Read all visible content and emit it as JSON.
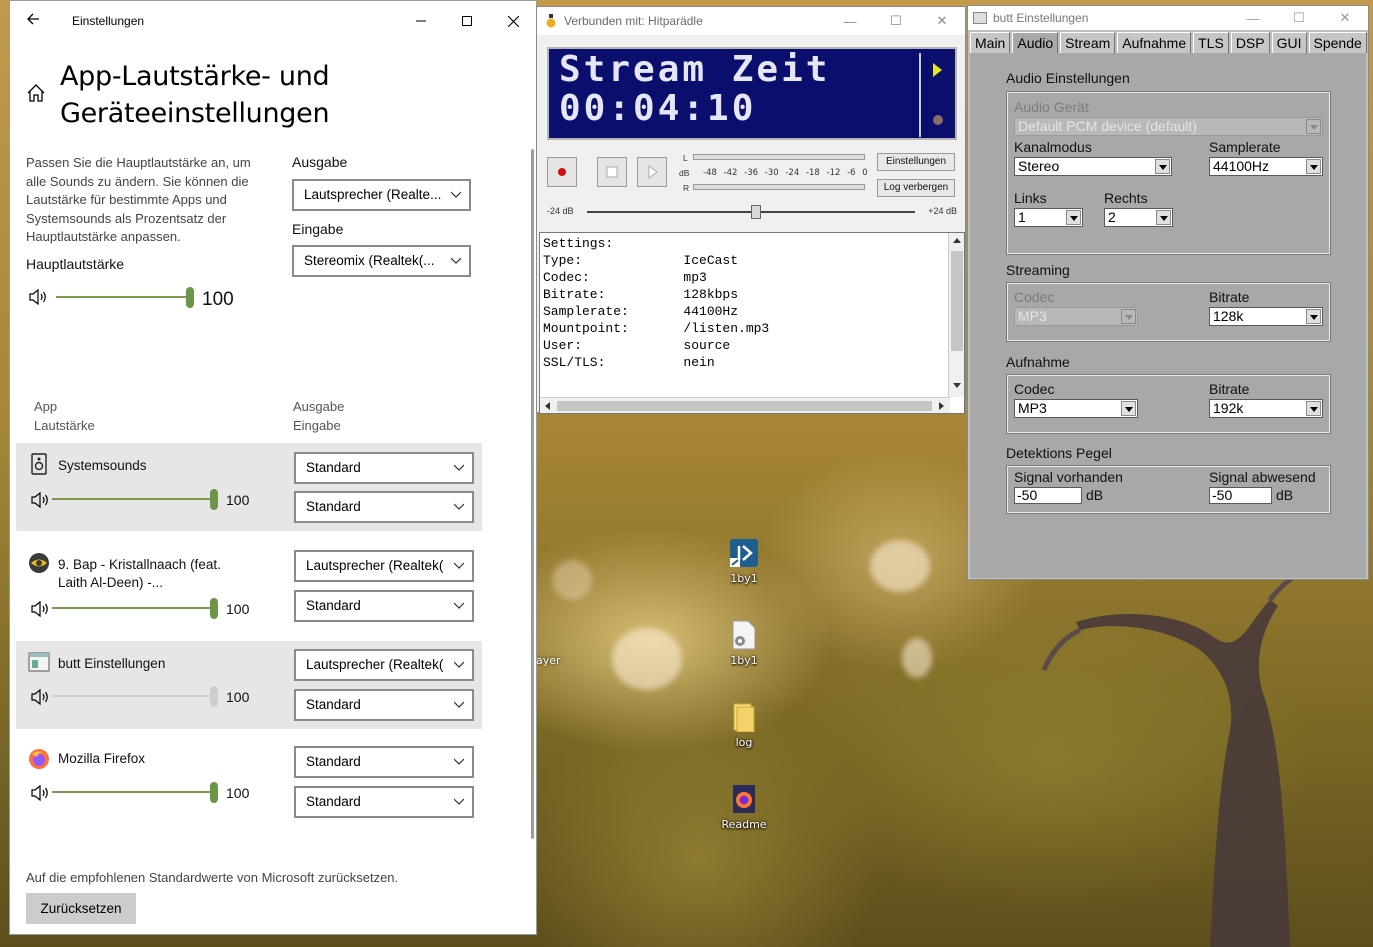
{
  "desktop": {
    "icons": [
      {
        "label": "1by1",
        "icon": "app-shortcut-icon"
      },
      {
        "label": "1by1",
        "icon": "config-file-icon"
      },
      {
        "label": "log",
        "icon": "folder-icon"
      },
      {
        "label": "Readme",
        "icon": "firefox-document-icon"
      }
    ],
    "partial_label": "ayer"
  },
  "settings": {
    "title": "Einstellungen",
    "heading_line1": "App-Lautstärke- und",
    "heading_line2": "Geräteeinstellungen",
    "description": "Passen Sie die Hauptlautstärke an, um alle Sounds zu ändern. Sie können die Lautstärke für bestimmte Apps und Systemsounds als Prozentsatz der Hauptlautstärke anpassen.",
    "master_label": "Hauptlautstärke",
    "master_volume": 100,
    "master_volume_text": "100",
    "output_label": "Ausgabe",
    "output_value": "Lautsprecher (Realte...",
    "input_label": "Eingabe",
    "input_value": "Stereomix (Realtek(...",
    "col_app": "App",
    "col_volume": "Lautstärke",
    "col_output": "Ausgabe",
    "col_input": "Eingabe",
    "apps": [
      {
        "name": "Systemsounds",
        "volume": "100",
        "output": "Standard",
        "input": "Standard"
      },
      {
        "name": "9. Bap - Kristallnaach (feat. Laith Al-Deen) -...",
        "name_line1": "9. Bap - Kristallnaach (feat.",
        "name_line2": "Laith Al-Deen) -...",
        "volume": "100",
        "output": "Lautsprecher (Realtek(",
        "input": "Standard"
      },
      {
        "name": "butt Einstellungen",
        "volume": "100",
        "output": "Lautsprecher (Realtek(",
        "input": "Standard"
      },
      {
        "name": "Mozilla Firefox",
        "volume": "100",
        "output": "Standard",
        "input": "Standard"
      }
    ],
    "reset_text": "Auf die empfohlenen Standardwerte von Microsoft zurücksetzen.",
    "reset_button": "Zurücksetzen"
  },
  "butt_main": {
    "title": "Verbunden mit: Hitparädle",
    "lcd_line1": "Stream Zeit",
    "lcd_line2": "00:04:10",
    "vu_top_label": "L",
    "vu_mid_label": "dB",
    "vu_bottom_label": "R",
    "vu_scale": "-48 -42 -36 -30 -24 -18 -12 -6 0",
    "settings_button": "Einstellungen",
    "log_button": "Log verbergen",
    "gain_min": "-24 dB",
    "gain_max": "+24 dB",
    "log_lines": [
      "Settings:",
      "Type:             IceCast",
      "Codec:            mp3",
      "Bitrate:          128kbps",
      "Samplerate:       44100Hz",
      "Mountpoint:       /listen.mp3",
      "User:             source",
      "SSL/TLS:          nein"
    ]
  },
  "butt_settings": {
    "title": "butt Einstellungen",
    "tabs": [
      "Main",
      "Audio",
      "Stream",
      "Aufnahme",
      "TLS",
      "DSP",
      "GUI",
      "Spende"
    ],
    "active_tab": "Audio",
    "audio_group": "Audio Einstellungen",
    "device_label": "Audio Gerät",
    "device_value": "Default PCM device (default)",
    "channel_label": "Kanalmodus",
    "channel_value": "Stereo",
    "samplerate_label": "Samplerate",
    "samplerate_value": "44100Hz",
    "left_label": "Links",
    "left_value": "1",
    "right_label": "Rechts",
    "right_value": "2",
    "streaming_group": "Streaming",
    "stream_codec_label": "Codec",
    "stream_codec_value": "MP3",
    "stream_bitrate_label": "Bitrate",
    "stream_bitrate_value": "128k",
    "record_group": "Aufnahme",
    "rec_codec_label": "Codec",
    "rec_codec_value": "MP3",
    "rec_bitrate_label": "Bitrate",
    "rec_bitrate_value": "192k",
    "detect_group": "Detektions Pegel",
    "signal_on_label": "Signal vorhanden",
    "signal_on_value": "-50",
    "signal_on_unit": "dB",
    "signal_off_label": "Signal abwesend",
    "signal_off_value": "-50",
    "signal_off_unit": "dB"
  }
}
